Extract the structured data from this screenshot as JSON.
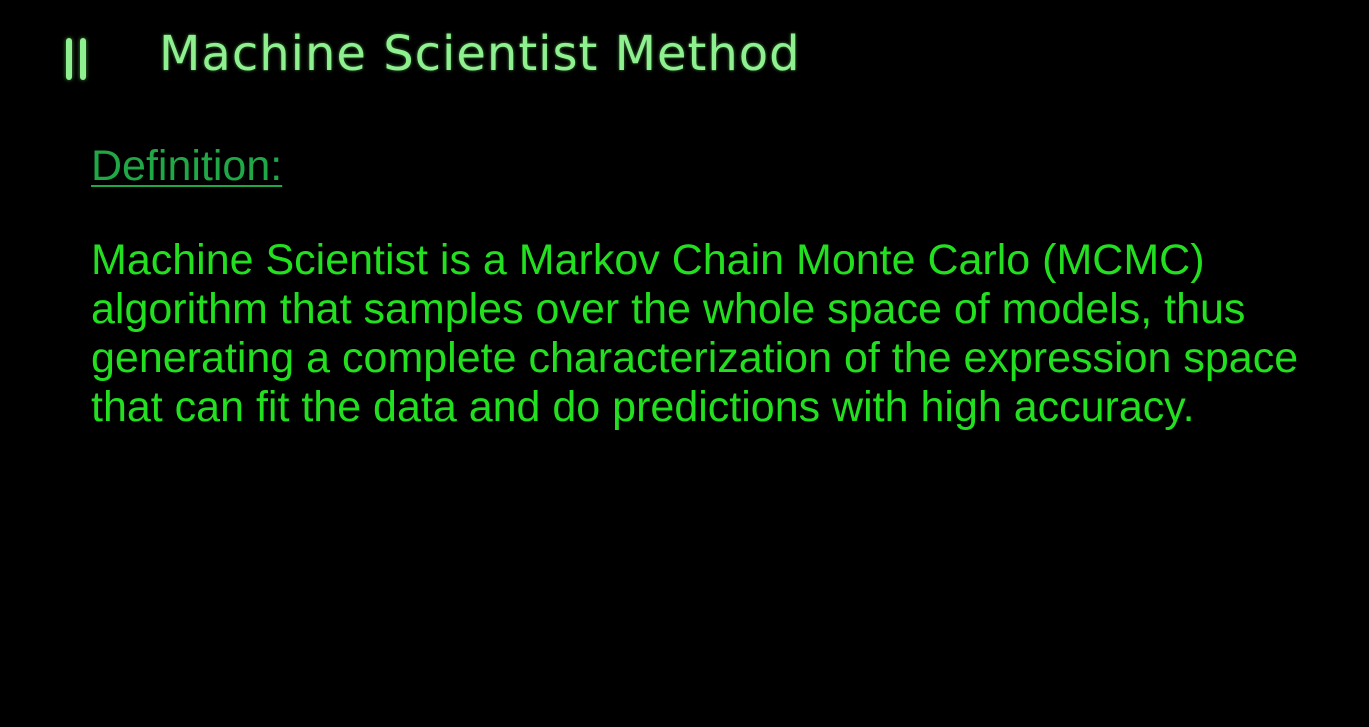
{
  "header": {
    "title": "Machine Scientist Method",
    "pause_icon": "pause-icon"
  },
  "definition": {
    "label": "Definition:",
    "text": "Machine Scientist is a Markov Chain Monte Carlo (MCMC) algorithm that samples over the whole space of models, thus generating a complete characterization of the expression space that can fit the data and do predictions with high accuracy."
  },
  "colors": {
    "background": "#000000",
    "title": "#8ef08e",
    "label": "#1fa845",
    "body_text": "#22e01f"
  }
}
